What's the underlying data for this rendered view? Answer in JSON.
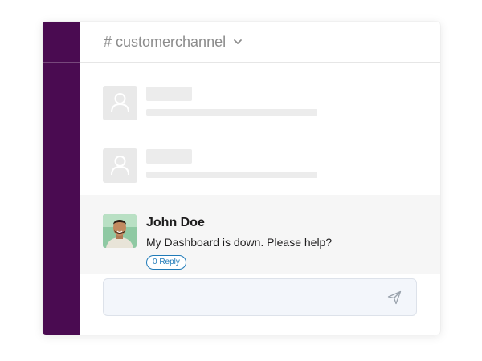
{
  "header": {
    "channel_name": "# customerchannel"
  },
  "message": {
    "author": "John Doe",
    "text": "My Dashboard is down. Please help?",
    "reply_label": "0 Reply"
  },
  "composer": {
    "placeholder": ""
  },
  "colors": {
    "sidebar": "#4a0b51",
    "reply_accent": "#1f7ab8",
    "message_bg": "#f6f6f6",
    "composer_bg": "#f3f6fb"
  },
  "icons": {
    "channel_dropdown": "chevron-down-icon",
    "placeholder_avatar": "user-icon",
    "send": "send-icon"
  }
}
